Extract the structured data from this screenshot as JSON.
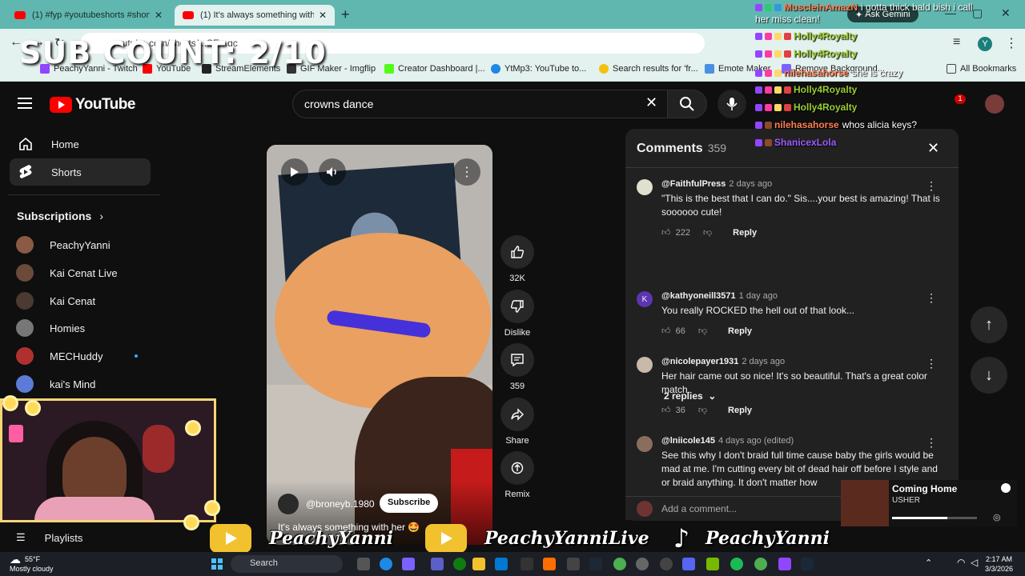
{
  "browser": {
    "tabs": [
      {
        "title": "(1) #fyp #youtubeshorts #short"
      },
      {
        "title": "(1) It's always something with h"
      }
    ],
    "ask_gemini": "Ask Gemini",
    "address_text": "youtube.com/shorts/...SE...gc",
    "avatar_letter": "Y",
    "bookmarks": [
      {
        "label": "PeachyYanni - Twitch",
        "color": "#9146ff"
      },
      {
        "label": "YouTube",
        "color": "#ff0000"
      },
      {
        "label": "StreamElements",
        "color": "#222222"
      },
      {
        "label": "GIF Maker - Imgflip",
        "color": "#333333"
      },
      {
        "label": "Creator Dashboard |...",
        "color": "#53fc18"
      },
      {
        "label": "YtMp3: YouTube to...",
        "color": "#1e88e5"
      },
      {
        "label": "Search results for 'fr...",
        "color": "#f4c20d"
      },
      {
        "label": "Emote Maker",
        "color": "#4a90e2"
      },
      {
        "label": "Remove Background...",
        "color": "#7b61ff"
      }
    ],
    "all_bookmarks": "All Bookmarks"
  },
  "overlay": {
    "sub_count": "SUB COUNT: 2/10",
    "banner": [
      "PeachyYanni",
      "PeachyYanniLive",
      "PeachyYanni"
    ]
  },
  "youtube": {
    "logo_text": "YouTube",
    "search_value": "crowns dance",
    "notification_count": "1",
    "sidebar": {
      "home": "Home",
      "shorts": "Shorts",
      "subscriptions_heading": "Subscriptions",
      "subscriptions": [
        {
          "name": "PeachyYanni",
          "color": "#8a5a44"
        },
        {
          "name": "Kai Cenat Live",
          "color": "#6b4a3a"
        },
        {
          "name": "Kai Cenat",
          "color": "#4b3a31"
        },
        {
          "name": "Homies",
          "color": "#777777"
        },
        {
          "name": "MECHuddy",
          "color": "#b03030"
        },
        {
          "name": "kai's Mind",
          "color": "#5c7bd9"
        }
      ],
      "playlists": "Playlists"
    },
    "short": {
      "channel": "@broneyb.1980",
      "subscribe": "Subscribe",
      "caption": "It's always something with her 🤩"
    },
    "actions": [
      {
        "id": "like",
        "label": "32K"
      },
      {
        "id": "dislike",
        "label": "Dislike"
      },
      {
        "id": "comments",
        "label": "359"
      },
      {
        "id": "share",
        "label": "Share"
      },
      {
        "id": "remix",
        "label": "Remix"
      }
    ],
    "comments": {
      "title": "Comments",
      "count": "359",
      "items": [
        {
          "author": "@FaithfulPress",
          "time": "2 days ago",
          "text": "\"This is the best that I can do.\" Sis....your best is amazing! That is soooooo cute!",
          "likes": "222",
          "reply": "Reply",
          "avatar_color": "#e0e0d0"
        },
        {
          "author": "@kathyoneill3571",
          "time": "1 day ago",
          "text": "You really ROCKED the hell out of that look...",
          "likes": "66",
          "reply": "Reply",
          "avatar_color": "#5e35b1",
          "avatar_letter": "K"
        },
        {
          "author": "@nicolepayer1931",
          "time": "2 days ago",
          "text": "Her hair came out so nice! It's so beautiful. That's a great color match.",
          "likes": "36",
          "reply": "Reply",
          "avatar_color": "#c9b9a8"
        },
        {
          "author": "@lniicole145",
          "time": "4 days ago (edited)",
          "text": "See this why I don't braid full time cause baby the girls would be mad at me. I'm cutting every bit of dead hair off before I style and or braid anything. It don't matter how",
          "avatar_color": "#8a6d5d"
        }
      ],
      "replies_toggle": "2 replies",
      "add_placeholder": "Add a comment..."
    }
  },
  "chat": [
    {
      "user": "MuscleinAmazN",
      "msg": "i gotta thick bald bish i call",
      "color": "#ff7f50"
    },
    {
      "user": "",
      "msg": "her miss clean!",
      "color": "#ffffff"
    },
    {
      "user": "Holly4Royalty",
      "msg": "",
      "color": "#9acd32"
    },
    {
      "user": "Holly4Royalty",
      "msg": "",
      "color": "#9acd32"
    },
    {
      "user": "nilehasahorse",
      "msg": "she is crazy",
      "color": "#ff7f50"
    },
    {
      "user": "Holly4Royalty",
      "msg": "",
      "color": "#9acd32"
    },
    {
      "user": "Holly4Royalty",
      "msg": "",
      "color": "#9acd32"
    },
    {
      "user": "nilehasahorse",
      "msg": "whos alicia keys?",
      "color": "#ff7f50"
    },
    {
      "user": "ShanicexLola",
      "msg": "",
      "color": "#9b5cff"
    }
  ],
  "music": {
    "song": "Coming Home",
    "artist": "USHER",
    "progress": 0.65
  },
  "taskbar": {
    "temp": "55°F",
    "weather": "Mostly cloudy",
    "search": "Search",
    "time": "2:17 AM",
    "date": "3/3/2026"
  }
}
